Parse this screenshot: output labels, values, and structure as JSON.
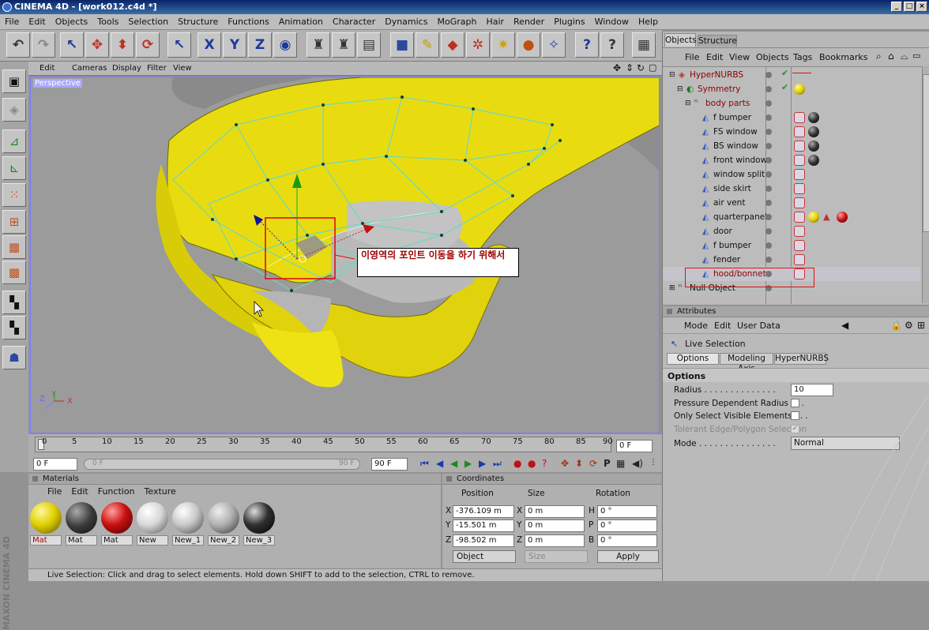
{
  "window": {
    "title": "CINEMA 4D - [work012.c4d *]",
    "min": "_",
    "max": "□",
    "close": "×"
  },
  "menubar": [
    "File",
    "Edit",
    "Objects",
    "Tools",
    "Selection",
    "Structure",
    "Functions",
    "Animation",
    "Character",
    "Dynamics",
    "MoGraph",
    "Hair",
    "Render",
    "Plugins",
    "Window",
    "Help"
  ],
  "viewport": {
    "menu": [
      "Edit",
      "Cameras",
      "Display",
      "Filter",
      "View"
    ],
    "label": "Perspective",
    "annotation": "이영역의 포인트 이동을 하기 위해서",
    "axis": {
      "x": "X",
      "y": "Y",
      "z": "Z"
    }
  },
  "timeline": {
    "ticks": [
      "0",
      "5",
      "10",
      "15",
      "20",
      "25",
      "30",
      "35",
      "40",
      "45",
      "50",
      "55",
      "60",
      "65",
      "70",
      "75",
      "80",
      "85",
      "90"
    ],
    "current": "0 F",
    "start": "0 F",
    "range_start": "0 F",
    "range_end": "90 F",
    "end": "90 F"
  },
  "materials": {
    "title": "Materials",
    "menu": [
      "File",
      "Edit",
      "Function",
      "Texture"
    ],
    "items": [
      {
        "name": "Mat",
        "color": "#e0d000"
      },
      {
        "name": "Mat",
        "color": "#3a3a3a"
      },
      {
        "name": "Mat",
        "color": "#c81010"
      },
      {
        "name": "New",
        "color": "#d8d8d8"
      },
      {
        "name": "New_1",
        "color": "#c8c8c8"
      },
      {
        "name": "New_2",
        "color": "#b0b0b0"
      },
      {
        "name": "New_3",
        "color": "#303030"
      }
    ]
  },
  "coordinates": {
    "title": "Coordinates",
    "headers": [
      "Position",
      "Size",
      "Rotation"
    ],
    "rows": [
      {
        "axis": "X",
        "pos": "-376.109 m",
        "size_axis": "X",
        "size": "0 m",
        "rot_axis": "H",
        "rot": "0 °"
      },
      {
        "axis": "Y",
        "pos": "-15.501 m",
        "size_axis": "Y",
        "size": "0 m",
        "rot_axis": "P",
        "rot": "0 °"
      },
      {
        "axis": "Z",
        "pos": "-98.502 m",
        "size_axis": "Z",
        "size": "0 m",
        "rot_axis": "B",
        "rot": "0 °"
      }
    ],
    "mode": "Object",
    "size_mode": "Size",
    "apply": "Apply"
  },
  "status": "Live Selection: Click and drag to select elements. Hold down SHIFT to add to the selection, CTRL to remove.",
  "objects": {
    "tabs": [
      "Objects",
      "Structure"
    ],
    "menu": [
      "File",
      "Edit",
      "View",
      "Objects",
      "Tags",
      "Bookmarks"
    ],
    "rows": [
      {
        "name": "HyperNURBS",
        "indent": 0,
        "color": "red"
      },
      {
        "name": "Symmetry",
        "indent": 1,
        "color": "red"
      },
      {
        "name": "body parts",
        "indent": 2,
        "color": "red"
      },
      {
        "name": "f bumper",
        "indent": 3,
        "color": "black"
      },
      {
        "name": "FS window",
        "indent": 3,
        "color": "black"
      },
      {
        "name": "BS window",
        "indent": 3,
        "color": "black"
      },
      {
        "name": "front window",
        "indent": 3,
        "color": "black"
      },
      {
        "name": "window split",
        "indent": 3,
        "color": "black"
      },
      {
        "name": "side skirt",
        "indent": 3,
        "color": "black"
      },
      {
        "name": "air vent",
        "indent": 3,
        "color": "black"
      },
      {
        "name": "quarterpanel",
        "indent": 3,
        "color": "black"
      },
      {
        "name": "door",
        "indent": 3,
        "color": "black"
      },
      {
        "name": "f bumper",
        "indent": 3,
        "color": "black"
      },
      {
        "name": "fender",
        "indent": 3,
        "color": "black"
      },
      {
        "name": "hood/bonnet",
        "indent": 3,
        "color": "red"
      },
      {
        "name": "Null Object",
        "indent": 0,
        "color": "black"
      }
    ]
  },
  "attributes": {
    "title": "Attributes",
    "menu": [
      "Mode",
      "Edit",
      "User Data"
    ],
    "tool": "Live Selection",
    "tabs": [
      "Options",
      "Modeling Axis",
      "HyperNURBS"
    ],
    "section": "Options",
    "radius_label": "Radius . . . . . . . . . . . . . .",
    "radius": "10",
    "pressure_label": "Pressure Dependent Radius . . .",
    "visible_label": "Only Select Visible Elements . . .",
    "tolerant_label": "Tolerant Edge/Polygon Selection",
    "mode_label": "Mode . . . . . . . . . . . . . . .",
    "mode": "Normal"
  },
  "branding": "MAXON CINEMA 4D"
}
